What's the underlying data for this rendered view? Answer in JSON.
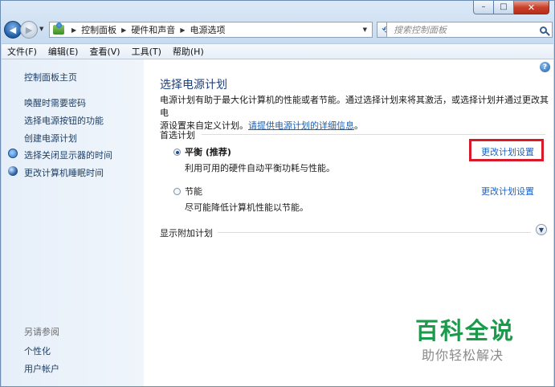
{
  "window": {
    "caption_buttons": [
      "–",
      "□",
      "✕"
    ]
  },
  "navigation": {
    "breadcrumbs": [
      "控制面板",
      "硬件和声音",
      "电源选项"
    ],
    "search_placeholder": "搜索控制面板"
  },
  "menu": [
    "文件(F)",
    "编辑(E)",
    "查看(V)",
    "工具(T)",
    "帮助(H)"
  ],
  "sidebar": {
    "home": "控制面板主页",
    "tasks": [
      "唤醒时需要密码",
      "选择电源按钮的功能",
      "创建电源计划",
      "选择关闭显示器的时间",
      "更改计算机睡眠时间"
    ],
    "see_also_title": "另请参阅",
    "see_also": [
      "个性化",
      "用户帐户"
    ]
  },
  "main": {
    "help": "?",
    "title": "选择电源计划",
    "desc_line1": "电源计划有助于最大化计算机的性能或者节能。通过选择计划来将其激活，或选择计划并通过更改其电",
    "desc_line2_text": "源设置来自定义计划。",
    "desc_link": "请提供电源计划的详细信息",
    "desc_end": "。",
    "preferred_group": "首选计划",
    "plans": [
      {
        "name": "平衡 (推荐)",
        "desc": "利用可用的硬件自动平衡功耗与性能。",
        "selected": true,
        "change": "更改计划设置"
      },
      {
        "name": "节能",
        "desc": "尽可能降低计算机性能以节能。",
        "selected": false,
        "change": "更改计划设置"
      }
    ],
    "more_plans": "显示附加计划"
  },
  "watermark": {
    "title": "百科全说",
    "subtitle": "助你轻松解决"
  },
  "colors": {
    "highlight_box": "#d8192a",
    "link": "#1a63c4",
    "title": "#1f3f7a",
    "watermark": "#1a9a4a"
  }
}
